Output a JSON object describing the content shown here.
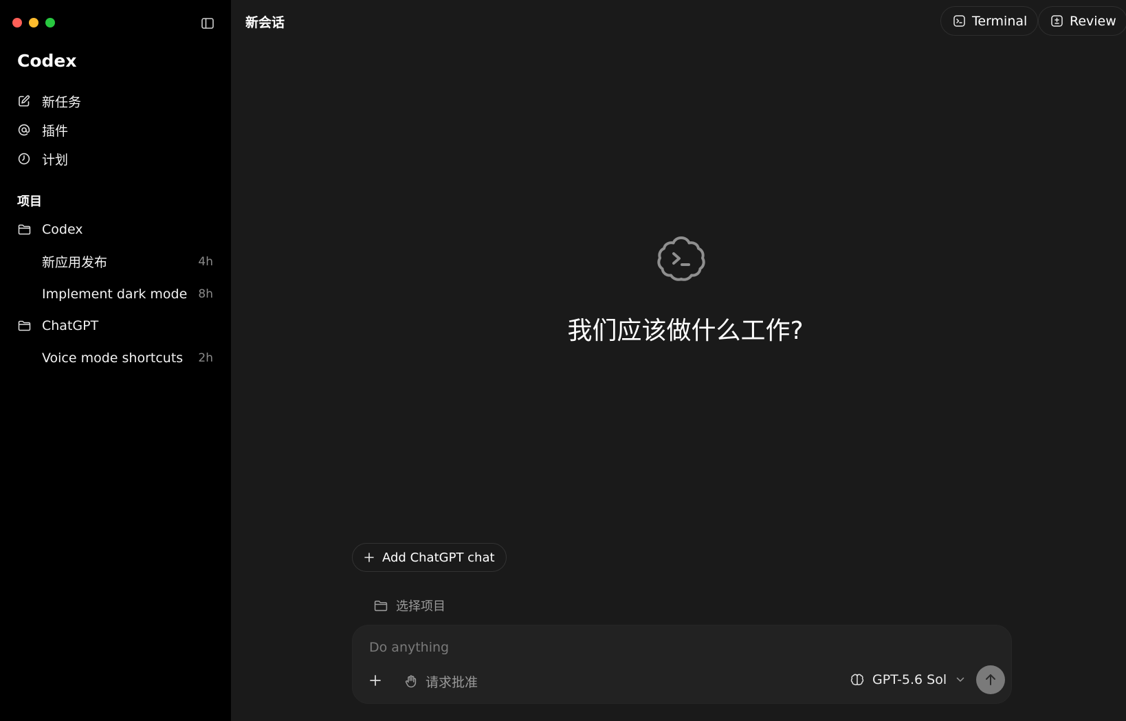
{
  "sidebar": {
    "brand": "Codex",
    "nav": [
      {
        "label": "新任务",
        "icon": "edit-icon"
      },
      {
        "label": "插件",
        "icon": "at-icon"
      },
      {
        "label": "计划",
        "icon": "clock-icon"
      }
    ],
    "projects_label": "项目",
    "projects": [
      {
        "name": "Codex",
        "icon": "folder-icon",
        "tasks": [
          {
            "title": "新应用发布",
            "time": "4h"
          },
          {
            "title": "Implement dark mode",
            "time": "8h"
          }
        ]
      },
      {
        "name": "ChatGPT",
        "icon": "folder-icon",
        "tasks": [
          {
            "title": "Voice mode shortcuts",
            "time": "2h"
          }
        ]
      }
    ]
  },
  "header": {
    "title": "新会话",
    "terminal_label": "Terminal",
    "review_label": "Review"
  },
  "hero": {
    "title": "我们应该做什么工作?"
  },
  "composer": {
    "add_chat_label": "Add ChatGPT chat",
    "select_project_label": "选择项目",
    "placeholder": "Do anything",
    "value": "",
    "approval_label": "请求批准",
    "model_label": "GPT-5.6 Sol"
  },
  "colors": {
    "sidebar_bg": "#000000",
    "main_bg": "#1a1a1a",
    "composer_bg": "#222222",
    "send_button": "#7a7a7a",
    "traffic_close": "#ff5f57",
    "traffic_min": "#febc2e",
    "traffic_max": "#28c840"
  }
}
